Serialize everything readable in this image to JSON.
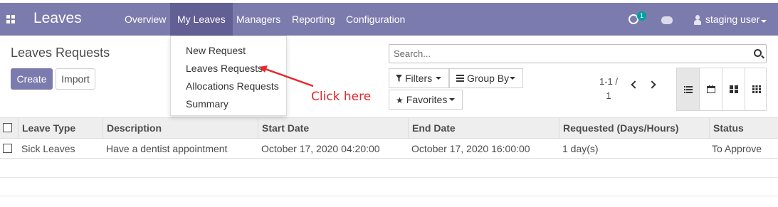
{
  "navbar": {
    "brand": "Leaves",
    "menus": [
      "Overview",
      "My Leaves",
      "Managers",
      "Reporting",
      "Configuration"
    ],
    "activity_badge": "1",
    "user": "staging user"
  },
  "control_panel": {
    "title": "Leaves Requests",
    "create_label": "Create",
    "import_label": "Import",
    "search_placeholder": "Search...",
    "filters_label": "Filters",
    "groupby_label": "Group By",
    "favorites_label": "Favorites",
    "pager_range": "1-1 /",
    "pager_total": "1",
    "views": [
      "list-icon",
      "calendar-icon",
      "kanban-icon",
      "grid-icon"
    ]
  },
  "dropdown": {
    "items": [
      "New Request",
      "Leaves Requests",
      "Allocations Requests",
      "Summary"
    ]
  },
  "annotation": {
    "text": "Click here",
    "color": "#e8262b"
  },
  "table": {
    "columns": [
      "Leave Type",
      "Description",
      "Start Date",
      "End Date",
      "Requested (Days/Hours)",
      "Status"
    ],
    "rows": [
      [
        "Sick Leaves",
        "Have a dentist appointment",
        "October 17, 2020 04:20:00",
        "October 17, 2020 16:00:00",
        "1 day(s)",
        "To Approve"
      ]
    ]
  },
  "colors": {
    "brand": "#7c7bad",
    "brand_active": "#625f94",
    "badge": "#00a09d"
  }
}
